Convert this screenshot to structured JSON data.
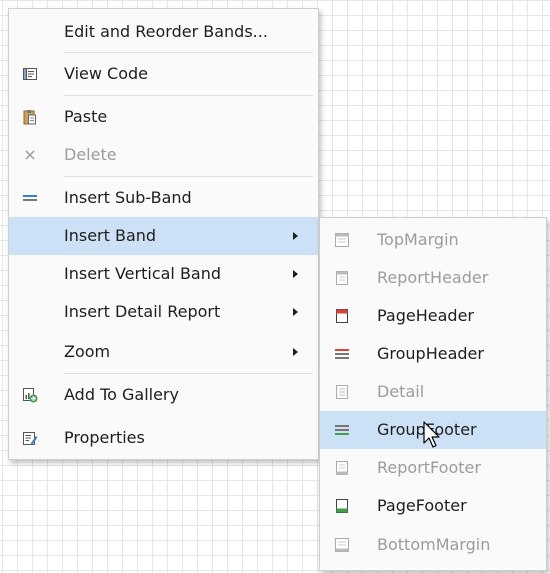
{
  "main_menu": {
    "items": [
      {
        "label": "Edit and Reorder Bands...",
        "icon": "none",
        "disabled": false
      },
      {
        "label": "View Code",
        "icon": "view-code-icon",
        "disabled": false
      },
      {
        "label": "Paste",
        "icon": "paste-icon",
        "disabled": false
      },
      {
        "label": "Delete",
        "icon": "delete-icon",
        "disabled": true
      },
      {
        "label": "Insert Sub-Band",
        "icon": "insert-sub-band-icon",
        "disabled": false
      },
      {
        "label": "Insert Band",
        "icon": "none",
        "disabled": false,
        "submenu": true,
        "active": true
      },
      {
        "label": "Insert Vertical Band",
        "icon": "none",
        "disabled": false,
        "submenu": true
      },
      {
        "label": "Insert Detail Report",
        "icon": "none",
        "disabled": false,
        "submenu": true
      },
      {
        "label": "Zoom",
        "icon": "none",
        "disabled": false,
        "submenu": true
      },
      {
        "label": "Add To Gallery",
        "icon": "add-to-gallery-icon",
        "disabled": false
      },
      {
        "label": "Properties",
        "icon": "properties-icon",
        "disabled": false
      }
    ]
  },
  "insert_band_submenu": {
    "items": [
      {
        "label": "TopMargin",
        "icon": "top-margin-icon",
        "disabled": true
      },
      {
        "label": "ReportHeader",
        "icon": "report-header-icon",
        "disabled": true
      },
      {
        "label": "PageHeader",
        "icon": "page-header-icon",
        "disabled": false
      },
      {
        "label": "GroupHeader",
        "icon": "group-header-icon",
        "disabled": false
      },
      {
        "label": "Detail",
        "icon": "detail-icon",
        "disabled": true
      },
      {
        "label": "GroupFooter",
        "icon": "group-footer-icon",
        "disabled": false,
        "hovered": true
      },
      {
        "label": "ReportFooter",
        "icon": "report-footer-icon",
        "disabled": true
      },
      {
        "label": "PageFooter",
        "icon": "page-footer-icon",
        "disabled": false
      },
      {
        "label": "BottomMargin",
        "icon": "bottom-margin-icon",
        "disabled": true
      }
    ]
  },
  "colors": {
    "highlight": "#cce1f6",
    "disabled_text": "#9c9c9c",
    "text": "#1e1e1e",
    "page_header_red": "#d9413b",
    "group_green": "#3fa14a",
    "page_footer_green": "#3fa14a",
    "sub_band_blue": "#3a7fc4"
  }
}
